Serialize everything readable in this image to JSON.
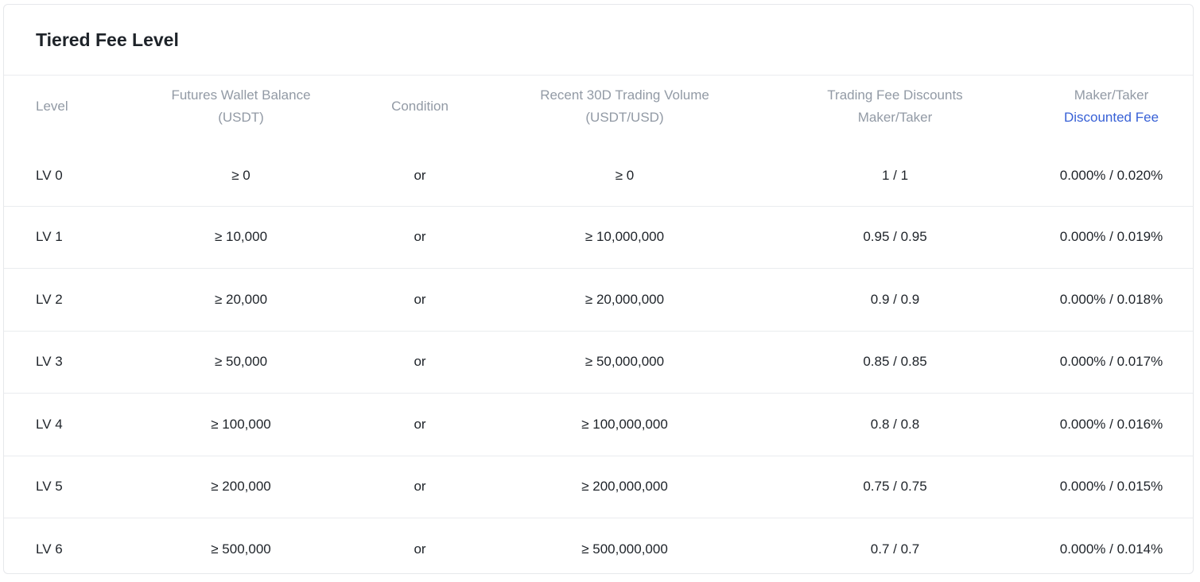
{
  "title": "Tiered Fee Level",
  "columns": {
    "level": "Level",
    "balance_line1": "Futures Wallet Balance",
    "balance_line2": "(USDT)",
    "condition": "Condition",
    "volume_line1": "Recent 30D Trading Volume",
    "volume_line2": "(USDT/USD)",
    "discounts_line1": "Trading Fee Discounts",
    "discounts_line2": "Maker/Taker",
    "fee_line1": "Maker/Taker",
    "fee_line2": "Discounted Fee"
  },
  "accent_color": "#3861d6",
  "rows": [
    {
      "level": "LV 0",
      "balance": "≥ 0",
      "condition": "or",
      "volume": "≥ 0",
      "discount": "1 / 1",
      "fee": "0.000% / 0.020%"
    },
    {
      "level": "LV 1",
      "balance": "≥ 10,000",
      "condition": "or",
      "volume": "≥ 10,000,000",
      "discount": "0.95 / 0.95",
      "fee": "0.000% / 0.019%"
    },
    {
      "level": "LV 2",
      "balance": "≥ 20,000",
      "condition": "or",
      "volume": "≥ 20,000,000",
      "discount": "0.9 / 0.9",
      "fee": "0.000% / 0.018%"
    },
    {
      "level": "LV 3",
      "balance": "≥ 50,000",
      "condition": "or",
      "volume": "≥ 50,000,000",
      "discount": "0.85 / 0.85",
      "fee": "0.000% / 0.017%"
    },
    {
      "level": "LV 4",
      "balance": "≥ 100,000",
      "condition": "or",
      "volume": "≥ 100,000,000",
      "discount": "0.8 / 0.8",
      "fee": "0.000% / 0.016%"
    },
    {
      "level": "LV 5",
      "balance": "≥ 200,000",
      "condition": "or",
      "volume": "≥ 200,000,000",
      "discount": "0.75 / 0.75",
      "fee": "0.000% / 0.015%"
    },
    {
      "level": "LV 6",
      "balance": "≥ 500,000",
      "condition": "or",
      "volume": "≥ 500,000,000",
      "discount": "0.7 / 0.7",
      "fee": "0.000% / 0.014%"
    }
  ]
}
